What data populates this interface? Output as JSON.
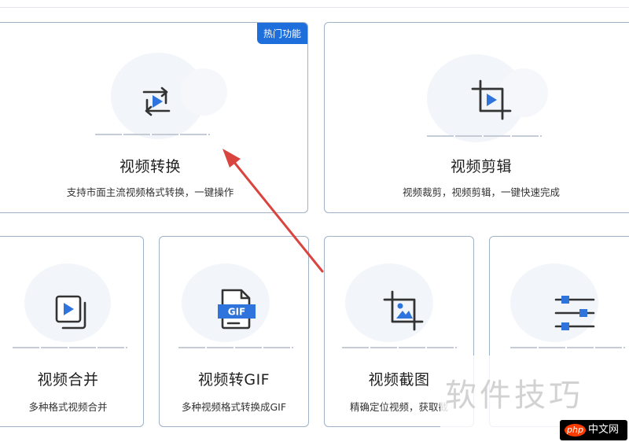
{
  "cards": [
    {
      "title": "视频转换",
      "desc": "支持市面主流视频格式转换，一键操作",
      "badge": "热门功能",
      "icon": "video-convert-icon"
    },
    {
      "title": "视频剪辑",
      "desc": "视频裁剪，视频剪辑，一键快速完成",
      "icon": "video-crop-icon"
    },
    {
      "title": "视频合并",
      "desc": "多种格式视频合并",
      "icon": "video-merge-icon"
    },
    {
      "title": "视频转GIF",
      "desc": "多种视频格式转换成GIF",
      "icon": "gif-file-icon",
      "icon_label": "GIF"
    },
    {
      "title": "视频截图",
      "desc": "精确定位视频，获取截",
      "icon": "image-crop-icon"
    },
    {
      "title": "",
      "desc": "",
      "icon": "sliders-icon"
    }
  ],
  "watermark": {
    "text": "软件技巧",
    "logo_php": "php",
    "logo_site": "中文网"
  },
  "colors": {
    "accent": "#1e6fdc",
    "arrow": "#d9443f",
    "border": "#9fb2c6"
  }
}
